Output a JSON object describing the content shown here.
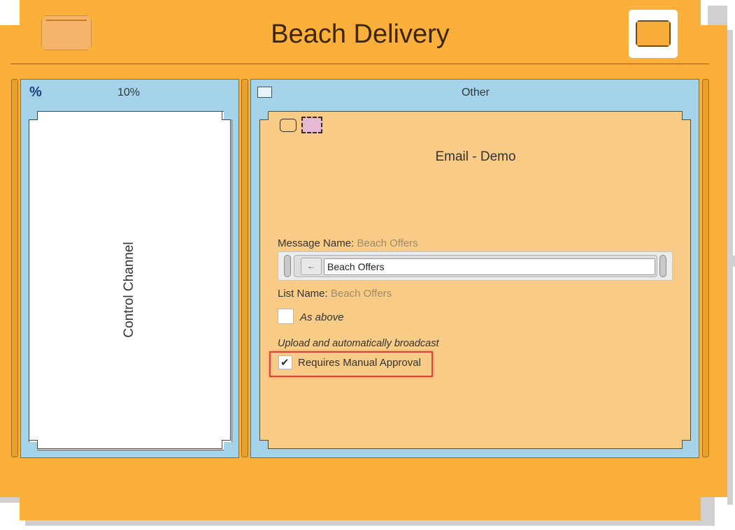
{
  "header": {
    "title": "Beach Delivery"
  },
  "left_panel": {
    "percent_symbol": "%",
    "percent_value": "10%",
    "card_label": "Control Channel"
  },
  "right_panel": {
    "header_label": "Other",
    "card_title": "Email - Demo",
    "message_name_label": "Message Name:",
    "message_name_value": "Beach Offers",
    "input_value": "Beach Offers",
    "input_button_glyph": "←",
    "list_name_label": "List Name:",
    "list_name_value": "Beach Offers",
    "as_above_label": "As above",
    "as_above_checked": false,
    "upload_label": "Upload and automatically broadcast",
    "manual_approval_label": "Requires Manual Approval",
    "manual_approval_checked": true,
    "check_glyph": "✔"
  },
  "colors": {
    "frame_orange": "#fbb03b",
    "panel_blue": "#a4d3ea",
    "card_peach": "#f8cc86",
    "highlight_red": "#e0413a"
  }
}
